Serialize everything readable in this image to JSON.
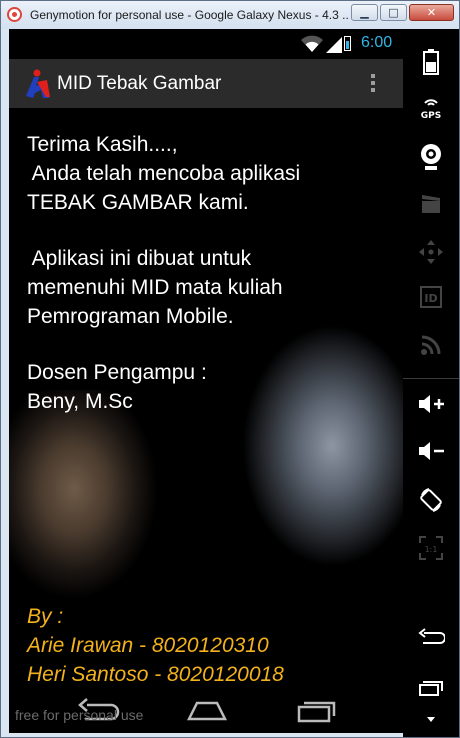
{
  "window": {
    "title": "Genymotion for personal use - Google Galaxy Nexus - 4.3 ...",
    "minimize_glyph": "▁",
    "maximize_glyph": "□",
    "close_glyph": "✕"
  },
  "statusbar": {
    "time": "6:00"
  },
  "actionbar": {
    "app_title": "MID Tebak Gambar"
  },
  "content": {
    "paragraph1": "Terima Kasih....,\n Anda telah mencoba aplikasi\nTEBAK GAMBAR kami.",
    "paragraph2": " Aplikasi ini dibuat untuk\nmemenuhi MID mata kuliah\nPemrograman Mobile.",
    "paragraph3": "Dosen Pengampu :\nBeny, M.Sc",
    "credits": "By :\nArie Irawan - 8020120310\nHeri Santoso - 8020120018"
  },
  "watermark": "free for personal use",
  "sidebar": {
    "gps_label": "GPS",
    "id_label": "ID",
    "ratio_label": "1:1"
  },
  "colors": {
    "accent": "#33b5e5",
    "credits": "#f3b21d",
    "actionbar": "#2b2b2b"
  }
}
